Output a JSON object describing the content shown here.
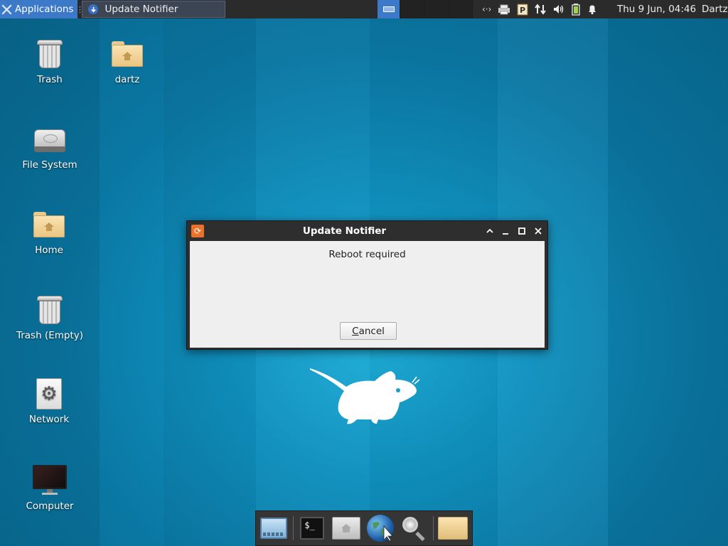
{
  "top_panel": {
    "applications_label": "Applications",
    "task_title": "Update Notifier",
    "clock": "Thu  9 Jun, 04:46",
    "user": "Dartz",
    "tray_icons": [
      "network-activity-icon",
      "printer-icon",
      "parcellite-icon",
      "transfer-arrows-icon",
      "volume-icon",
      "battery-icon",
      "notification-bell-icon"
    ]
  },
  "desktop": {
    "icons": [
      {
        "label": "Trash",
        "icon": "trash-icon"
      },
      {
        "label": "dartz",
        "icon": "home-folder-icon"
      },
      {
        "label": "File System",
        "icon": "drive-icon"
      },
      {
        "label": "Home",
        "icon": "home-folder-icon"
      },
      {
        "label": "Trash (Empty)",
        "icon": "trash-icon"
      },
      {
        "label": "Network",
        "icon": "settings-icon"
      },
      {
        "label": "Computer",
        "icon": "monitor-icon"
      }
    ]
  },
  "dialog": {
    "title": "Update Notifier",
    "message": "Reboot required",
    "cancel_prefix": "",
    "cancel_mnemonic": "C",
    "cancel_rest": "ancel",
    "controls": [
      "roll-up",
      "minimize",
      "maximize",
      "close"
    ]
  },
  "dock": {
    "items": [
      "show-desktop-icon",
      "terminal-icon",
      "home-icon",
      "web-browser-icon",
      "app-finder-icon",
      "file-manager-icon"
    ]
  }
}
